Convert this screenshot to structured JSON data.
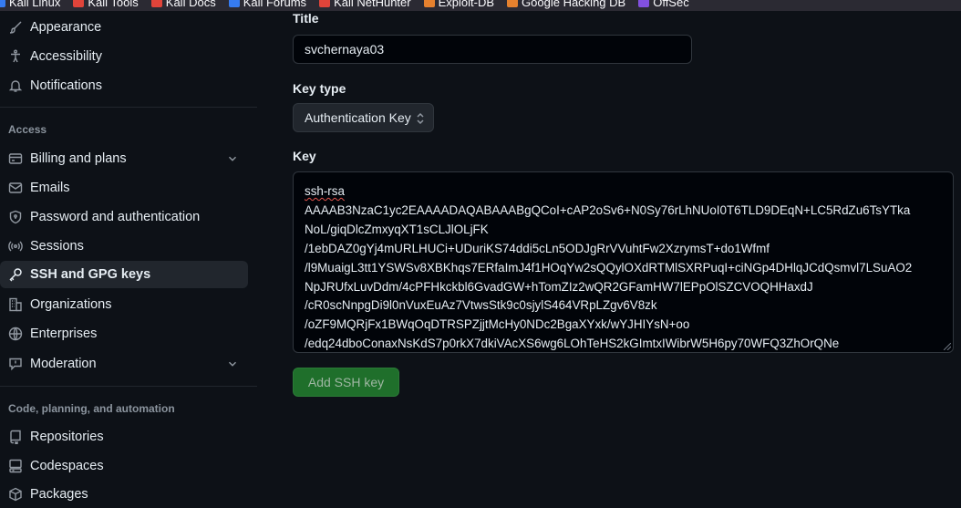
{
  "bookmarks": [
    {
      "label": "Kali Linux",
      "icon": "kali-icon"
    },
    {
      "label": "Kali Tools",
      "icon": "kali-tools-icon"
    },
    {
      "label": "Kali Docs",
      "icon": "kali-docs-icon"
    },
    {
      "label": "Kali Forums",
      "icon": "kali-forums-icon"
    },
    {
      "label": "Kali NetHunter",
      "icon": "nethunter-icon"
    },
    {
      "label": "Exploit-DB",
      "icon": "exploit-db-icon"
    },
    {
      "label": "Google Hacking DB",
      "icon": "ghdb-icon"
    },
    {
      "label": "OffSec",
      "icon": "offsec-icon"
    }
  ],
  "sidebar": {
    "top_items": [
      {
        "label": "Appearance",
        "icon": "paintbrush-icon"
      },
      {
        "label": "Accessibility",
        "icon": "accessibility-icon"
      },
      {
        "label": "Notifications",
        "icon": "bell-icon"
      }
    ],
    "access_label": "Access",
    "access_items": [
      {
        "label": "Billing and plans",
        "icon": "credit-card-icon",
        "expandable": true
      },
      {
        "label": "Emails",
        "icon": "mail-icon"
      },
      {
        "label": "Password and authentication",
        "icon": "shield-lock-icon"
      },
      {
        "label": "Sessions",
        "icon": "broadcast-icon"
      },
      {
        "label": "SSH and GPG keys",
        "icon": "key-icon",
        "active": true
      },
      {
        "label": "Organizations",
        "icon": "organization-icon"
      },
      {
        "label": "Enterprises",
        "icon": "globe-icon"
      },
      {
        "label": "Moderation",
        "icon": "report-icon",
        "expandable": true
      }
    ],
    "code_label": "Code, planning, and automation",
    "code_items": [
      {
        "label": "Repositories",
        "icon": "repo-icon"
      },
      {
        "label": "Codespaces",
        "icon": "codespaces-icon"
      },
      {
        "label": "Packages",
        "icon": "package-icon"
      }
    ]
  },
  "form": {
    "title_label": "Title",
    "title_value": "svchernaya03",
    "key_type_label": "Key type",
    "key_type_value": "Authentication Key",
    "key_label": "Key",
    "key_lines": [
      "ssh-rsa",
      "AAAAB3NzaC1yc2EAAAADAQABAAABgQCoI+cAP2oSv6+N0Sy76rLhNUoI0T6TLD9DEqN+LC5RdZu6TsYTka",
      "NoL/giqDlcZmxyqXT1sCLJlOLjFK",
      "/1ebDAZ0gYj4mURLHUCi+UDuriKS74ddi5cLn5ODJgRrVVuhtFw2XzrymsT+do1Wfmf",
      "/l9MuaigL3tt1YSWSv8XBKhqs7ERfaImJ4f1HOqYw2sQQylOXdRTMlSXRPuqI+ciNGp4DHlqJCdQsmvl7LSuAO2",
      "NpJRUfxLuvDdm/4cPFHkckbl6GvadGW+hTomZIz2wQR2GFamHW7lEPpOlSZCVOQHHaxdJ",
      "/cR0scNnpgDi9l0nVuxEuAz7VtwsStk9c0sjylS464VRpLZgv6V8zk",
      "/oZF9MQRjFx1BWqOqDTRSPZjjtMcHy0NDc2BgaXYxk/wYJHIYsN+oo",
      "/edq24dboConaxNsKdS7p0rkX7dkiVAcXS6wg6LOhTeHS2kGImtxIWibrW5H6py70WFQ3ZhOrQNe"
    ],
    "submit_label": "Add SSH key"
  },
  "colors": {
    "background": "#0d1117",
    "accent": "#2f81f7",
    "button_green": "#1f6f2b"
  }
}
